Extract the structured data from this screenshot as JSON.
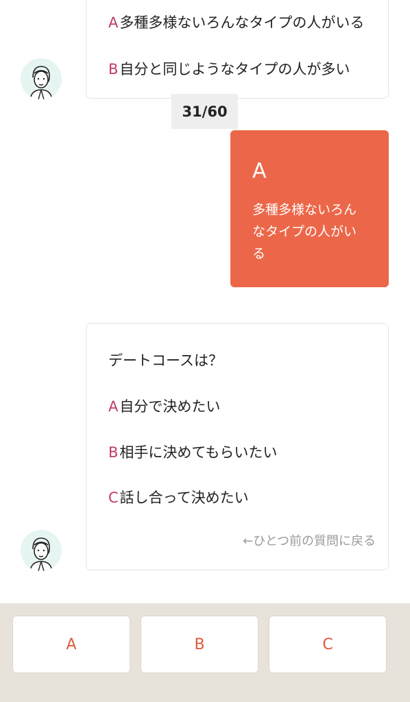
{
  "previous_question": {
    "options": [
      {
        "letter": "A",
        "text": "多種多様ないろんなタイプの人がいる"
      },
      {
        "letter": "B",
        "text": "自分と同じようなタイプの人が多い"
      }
    ]
  },
  "progress": {
    "label": "31/60",
    "current": 31,
    "total": 60
  },
  "user_answer": {
    "letter": "A",
    "text": "多種多様ないろんなタイプの人がいる"
  },
  "current_question": {
    "text": "デートコースは？",
    "options": [
      {
        "letter": "A",
        "text": "自分で決めたい"
      },
      {
        "letter": "B",
        "text": "相手に決めてもらいたい"
      },
      {
        "letter": "C",
        "text": "話し合って決めたい"
      }
    ],
    "back_link": "←ひとつ前の質問に戻る"
  },
  "answer_buttons": [
    "A",
    "B",
    "C"
  ],
  "colors": {
    "accent": "#ec6749",
    "option_letter": "#c0396e",
    "bottom_bar": "#e7e3da"
  }
}
